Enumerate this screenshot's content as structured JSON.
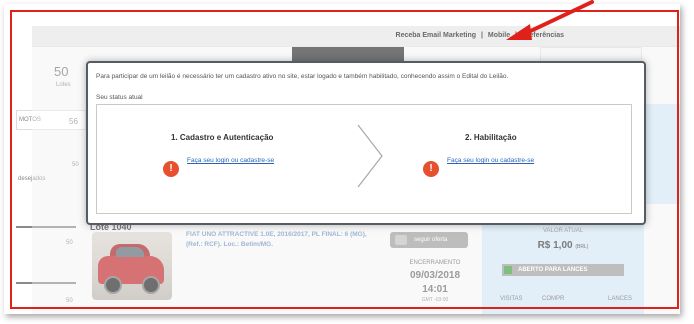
{
  "topbar": {
    "links": [
      "Receba Email Marketing",
      "Mobile",
      "Preferências"
    ],
    "separator": "|"
  },
  "left_stats": {
    "lotes_count": "50",
    "lotes_label": "Lotes",
    "tab_label": "MOTOS",
    "tab_count": "56",
    "visualizados_count": "50",
    "visualizados_label": "desejados",
    "row1_count": "50",
    "row2_count": "50"
  },
  "modal": {
    "intro_text": "Para participar de um leilão é necessário ter um cadastro ativo no site, estar logado e também habilitado, conhecendo assim o Edital do Leilão.",
    "status_text": "Seu status atual",
    "step1_title": "1. Cadastro e Autenticação",
    "step1_link": "Faça seu login ou cadastre-se",
    "step2_title": "2. Habilitação",
    "step2_link": "Faça seu login ou cadastre-se",
    "warn_glyph": "!"
  },
  "lot": {
    "id": "Lote 1040",
    "description": "FIAT UNO ATTRACTIVE 1.0E, 2016/2017, PL FINAL: 6 (MG), (Ref.: RCF). Loc.: Betim/MG.",
    "follow_label": "seguir oferta",
    "encerramento_label": "ENCERRAMENTO",
    "date": "09/03/2018",
    "time": "14:01",
    "timezone": "GMT -03:00",
    "valor_label": "VALOR ATUAL",
    "valor": "R$ 1,00",
    "valor_suffix": "(BRL)",
    "status_button": "ABERTO PARA LANCES",
    "col_visitas": "VISITAS",
    "col_compr": "COMPR",
    "col_lances": "LANCES"
  },
  "colors": {
    "annotation_red": "#e0201a",
    "link_blue": "#2a63b8",
    "warn_orange": "#e6502e",
    "panel_blue": "#d3e6f4"
  },
  "icons": [
    "warning-icon",
    "chevron-right-icon",
    "red-arrow-annotation",
    "follow-icon"
  ]
}
